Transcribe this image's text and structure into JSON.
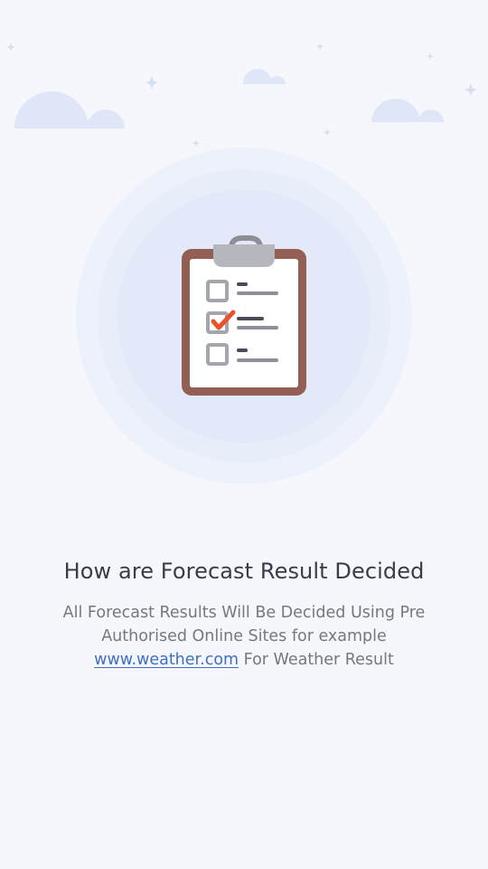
{
  "screen": {
    "illustration_icon": "clipboard-checklist-icon",
    "title": "How are Forecast Result Decided",
    "description": {
      "line1": "All Forecast Results Will Be Decided Using Pre",
      "line2": "Authorised Online Sites for example",
      "link_text": "www.weather.com",
      "line3_suffix": " For Weather Result"
    }
  },
  "colors": {
    "background": "#f5f7fc",
    "title": "#3b3b4c",
    "body_text": "#76777f",
    "link": "#3f6fc4",
    "clipboard_frame": "#935f55",
    "check_mark": "#e8532a",
    "cloud": "#dfe6f7"
  }
}
